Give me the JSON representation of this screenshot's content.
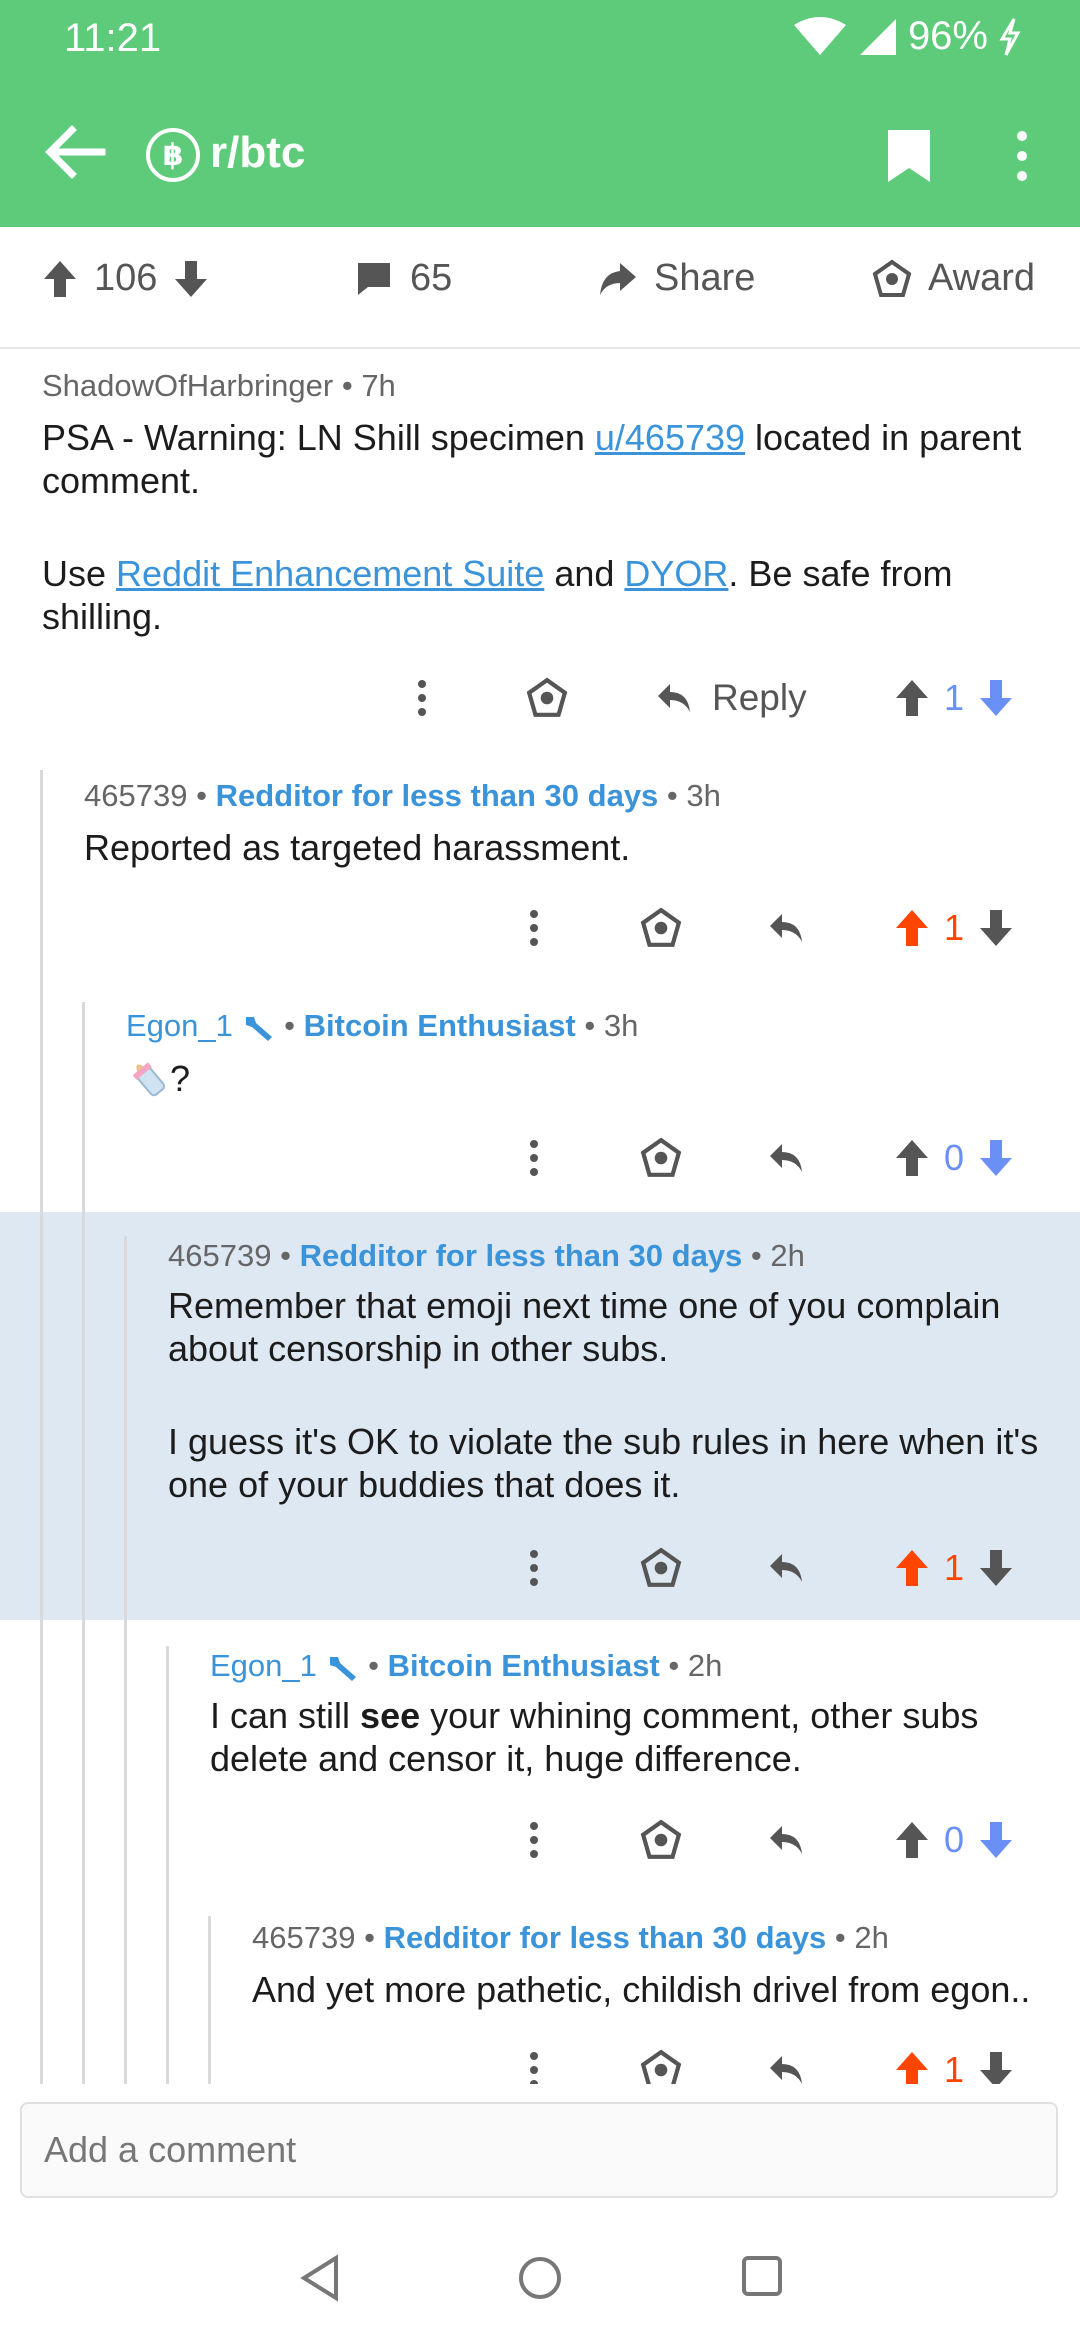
{
  "status_bar": {
    "time": "11:21",
    "battery": "96%"
  },
  "app_bar": {
    "subreddit": "r/btc",
    "sub_icon_glyph": "฿",
    "icons": [
      "back-arrow-icon",
      "bitcoin-icon",
      "bookmark-icon",
      "more-vert-icon"
    ]
  },
  "post_actions": {
    "upvotes": "106",
    "comments": "65",
    "share": "Share",
    "award": "Award"
  },
  "comments": [
    {
      "author": "ShadowOfHarbringer",
      "flair": "",
      "time": "7h",
      "body_a": "PSA - Warning: LN Shill specimen ",
      "link_user": "u/465739",
      "body_b": " located in parent comment.",
      "body2_a": "Use ",
      "link_res": "Reddit Enhancement Suite",
      "body2_b": " and ",
      "link_dyor": "DYOR",
      "body2_c": ". Be safe from shilling.",
      "reply": "Reply",
      "score": "1"
    },
    {
      "author": "465739",
      "flair": "Redditor for less than 30 days",
      "time": "3h",
      "body": "Reported as targeted harassment.",
      "score": "1"
    },
    {
      "author": "Egon_1",
      "flair": "Bitcoin Enthusiast",
      "time": "3h",
      "body": "?",
      "score": "0"
    },
    {
      "author": "465739",
      "flair": "Redditor for less than 30 days",
      "time": "2h",
      "body_p1": "Remember that emoji next time one of you complain about censorship in other subs.",
      "body_p2": "I guess it's OK to violate the sub rules in here when it's one of your buddies that does it.",
      "score": "1"
    },
    {
      "author": "Egon_1",
      "flair": "Bitcoin Enthusiast",
      "time": "2h",
      "body_a": "I can still ",
      "body_bold": "see",
      "body_b": " your whining comment, other subs delete and censor it, huge difference.",
      "score": "0"
    },
    {
      "author": "465739",
      "flair": "Redditor for less than 30 days",
      "time": "2h",
      "body": "And yet more pathetic, childish drivel from egon..",
      "score": "1"
    }
  ],
  "separator": "•",
  "composer": {
    "placeholder": "Add a comment"
  },
  "colors": {
    "app_green": "#5dcb79",
    "link_blue": "#3b94d9",
    "upvote_orange": "#ff4500",
    "downvote_blue": "#6a8ff5",
    "highlight": "#dde8f2"
  }
}
